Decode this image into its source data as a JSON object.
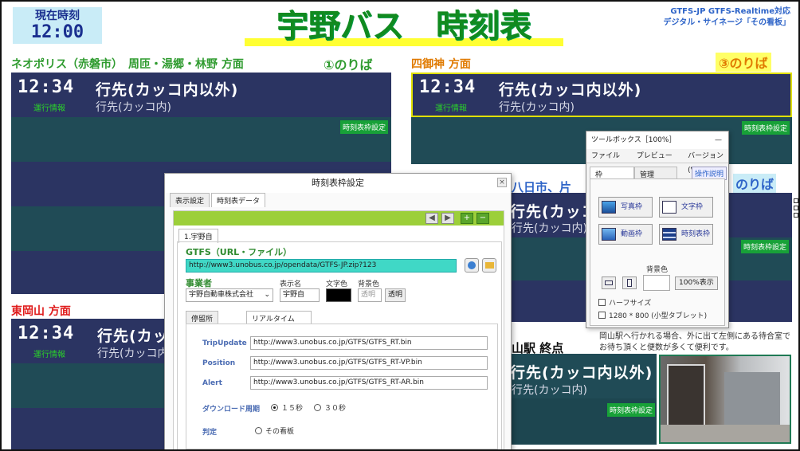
{
  "header": {
    "clock_label": "現在時刻",
    "clock_time": "12:00",
    "title": "宇野バス　時刻表",
    "top_right_line1": "GTFS-JP GTFS-Realtime対応",
    "top_right_line2": "デジタル・サイネージ「その看板」"
  },
  "board_common": {
    "time": "12:34",
    "dest": "行先(カッコ内以外)",
    "sub": "行先(カッコ内)",
    "info": "運行情報",
    "setting_button": "時刻表枠設定"
  },
  "board1": {
    "section": "ネオポリス（赤磐市）　周匝・湯郷・林野 方面",
    "platform": "①のりば"
  },
  "board2": {
    "section": "四御神 方面",
    "platform": "③のりば"
  },
  "board3": {
    "section": "八日市、片",
    "platform": "のりば"
  },
  "board4": {
    "section": "東岡山 方面"
  },
  "board5": {
    "section": "山駅 終点",
    "note_line1": "岡山駅へ行かれる場合、外に出て左側にある待合室で",
    "note_line2": "お待ち頂くと便数が多くて便利です。"
  },
  "dialog": {
    "title": "時刻表枠設定",
    "close": "×",
    "tab1": "表示設定",
    "tab2": "時刻表データ",
    "subtab": "1.宇野自",
    "gtfs_label": "GTFS（URL・ファイル）",
    "gtfs_url": "http://www3.unobus.co.jp/opendata/GTFS-JP.zip?123",
    "operator_label": "事業者",
    "operator_value": "宇野自動車株式会社",
    "display_name_label": "表示名",
    "display_name_value": "宇野自",
    "text_color_label": "文字色",
    "bg_color_label": "背景色",
    "transparent_field": "透明",
    "transparent_button": "透明",
    "tab_stop": "停留所",
    "tab_rt": "リアルタイム",
    "trip_label": "TripUpdate",
    "trip_url": "http://www3.unobus.co.jp/GTFS/GTFS_RT.bin",
    "pos_label": "Position",
    "pos_url": "http://www3.unobus.co.jp/GTFS/GTFS_RT-VP.bin",
    "alert_label": "Alert",
    "alert_url": "http://www3.unobus.co.jp/GTFS/GTFS_RT-AR.bin",
    "period_label": "ダウンロード周期",
    "opt15": "１５秒",
    "opt30": "３０秒",
    "judge_label": "判定",
    "judge_opt": "その看板"
  },
  "toolbox": {
    "title": "ツールボックス［100%］",
    "menu_file": "ファイル(E)",
    "menu_preview": "プレビュー(P)",
    "menu_version": "バージョン(V)",
    "tab_frame": "枠",
    "tab_manage": "管理",
    "help": "操作説明",
    "btn_photo": "写真枠",
    "btn_text": "文字枠",
    "btn_video": "動画枠",
    "btn_timetable": "時刻表枠",
    "bg_label": "背景色",
    "btn_100": "100%表示",
    "chk_half": "ハーフサイズ",
    "chk_tablet": "1280 * 800 (小型タブレット)"
  },
  "colors": {
    "board_dark": "#2b3462",
    "board_teal": "#204b56",
    "accent_green": "#9ccf3a",
    "title_green": "#118a1f"
  }
}
